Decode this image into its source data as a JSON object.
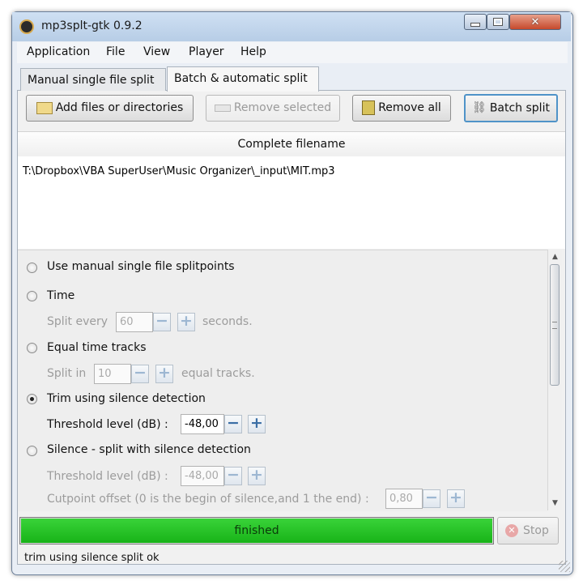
{
  "window": {
    "title": "mp3splt-gtk 0.9.2"
  },
  "menu": [
    "Application",
    "File",
    "View",
    "Player",
    "Help"
  ],
  "tabs": {
    "manual": "Manual single file split",
    "batch": "Batch & automatic split"
  },
  "toolbar": {
    "add": "Add files or directories",
    "remove_selected": "Remove selected",
    "remove_all": "Remove all",
    "batch_split": "Batch split"
  },
  "files": {
    "header": "Complete filename",
    "rows": [
      "T:\\Dropbox\\VBA SuperUser\\Music Organizer\\_input\\MIT.mp3"
    ]
  },
  "options": {
    "manual": "Use manual single file splitpoints",
    "time": "Time",
    "split_every": "Split every",
    "split_every_value": "60",
    "seconds": "seconds.",
    "equal": "Equal time tracks",
    "split_in": "Split in",
    "split_in_value": "10",
    "equal_tracks": "equal tracks.",
    "trim": "Trim using silence detection",
    "trim_threshold_label": "Threshold level (dB) :",
    "trim_threshold_value": "-48,00",
    "silence": "Silence - split with silence detection",
    "silence_threshold_label": "Threshold level (dB) :",
    "silence_threshold_value": "-48,00",
    "cutpoint_label": "Cutpoint offset (0 is the begin of silence,and 1 the end) :",
    "cutpoint_value": "0,80"
  },
  "progress": {
    "text": "finished",
    "fraction": 1.0,
    "color": "#22c022"
  },
  "stop": "Stop",
  "status": "trim using silence split ok"
}
